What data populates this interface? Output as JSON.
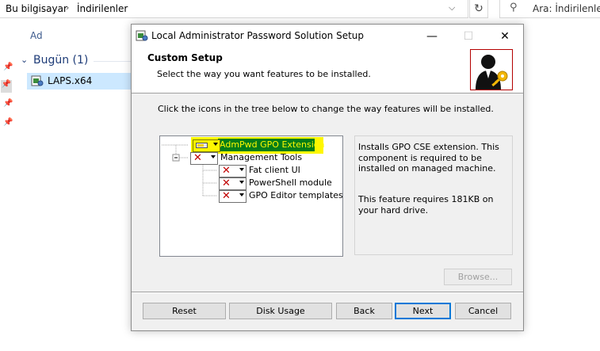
{
  "explorer": {
    "breadcrumb": [
      "Bu bilgisayar",
      "İndirilenler"
    ],
    "search_placeholder": "Ara: İndirilenler",
    "column_header": "Ad",
    "group_label": "Bugün (1)",
    "file_name": "LAPS.x64"
  },
  "dialog": {
    "title": "Local Administrator Password Solution Setup",
    "banner_title": "Custom Setup",
    "banner_subtitle": "Select the way you want features to be installed.",
    "instruction": "Click the icons in the tree below to change the way features will be installed.",
    "tree": [
      {
        "label": "AdmPwd GPO Extension",
        "state": "install",
        "highlighted": true
      },
      {
        "label": "Management Tools",
        "state": "unavailable"
      },
      {
        "label": "Fat client UI",
        "state": "unavailable"
      },
      {
        "label": "PowerShell module",
        "state": "unavailable"
      },
      {
        "label": "GPO Editor templates",
        "state": "unavailable"
      }
    ],
    "description_1": "Installs GPO CSE extension. This component is required to be installed on managed machine.",
    "description_2": "This feature requires 181KB on your hard drive.",
    "browse_label": "Browse...",
    "buttons": {
      "reset": "Reset",
      "disk_usage": "Disk Usage",
      "back": "Back",
      "next": "Next",
      "cancel": "Cancel"
    }
  },
  "colors": {
    "highlight_yellow": "#fff700",
    "highlight_green": "#007d19",
    "selection_blue": "#cce8ff",
    "accent_blue": "#0078d7",
    "x_red": "#c00000"
  }
}
